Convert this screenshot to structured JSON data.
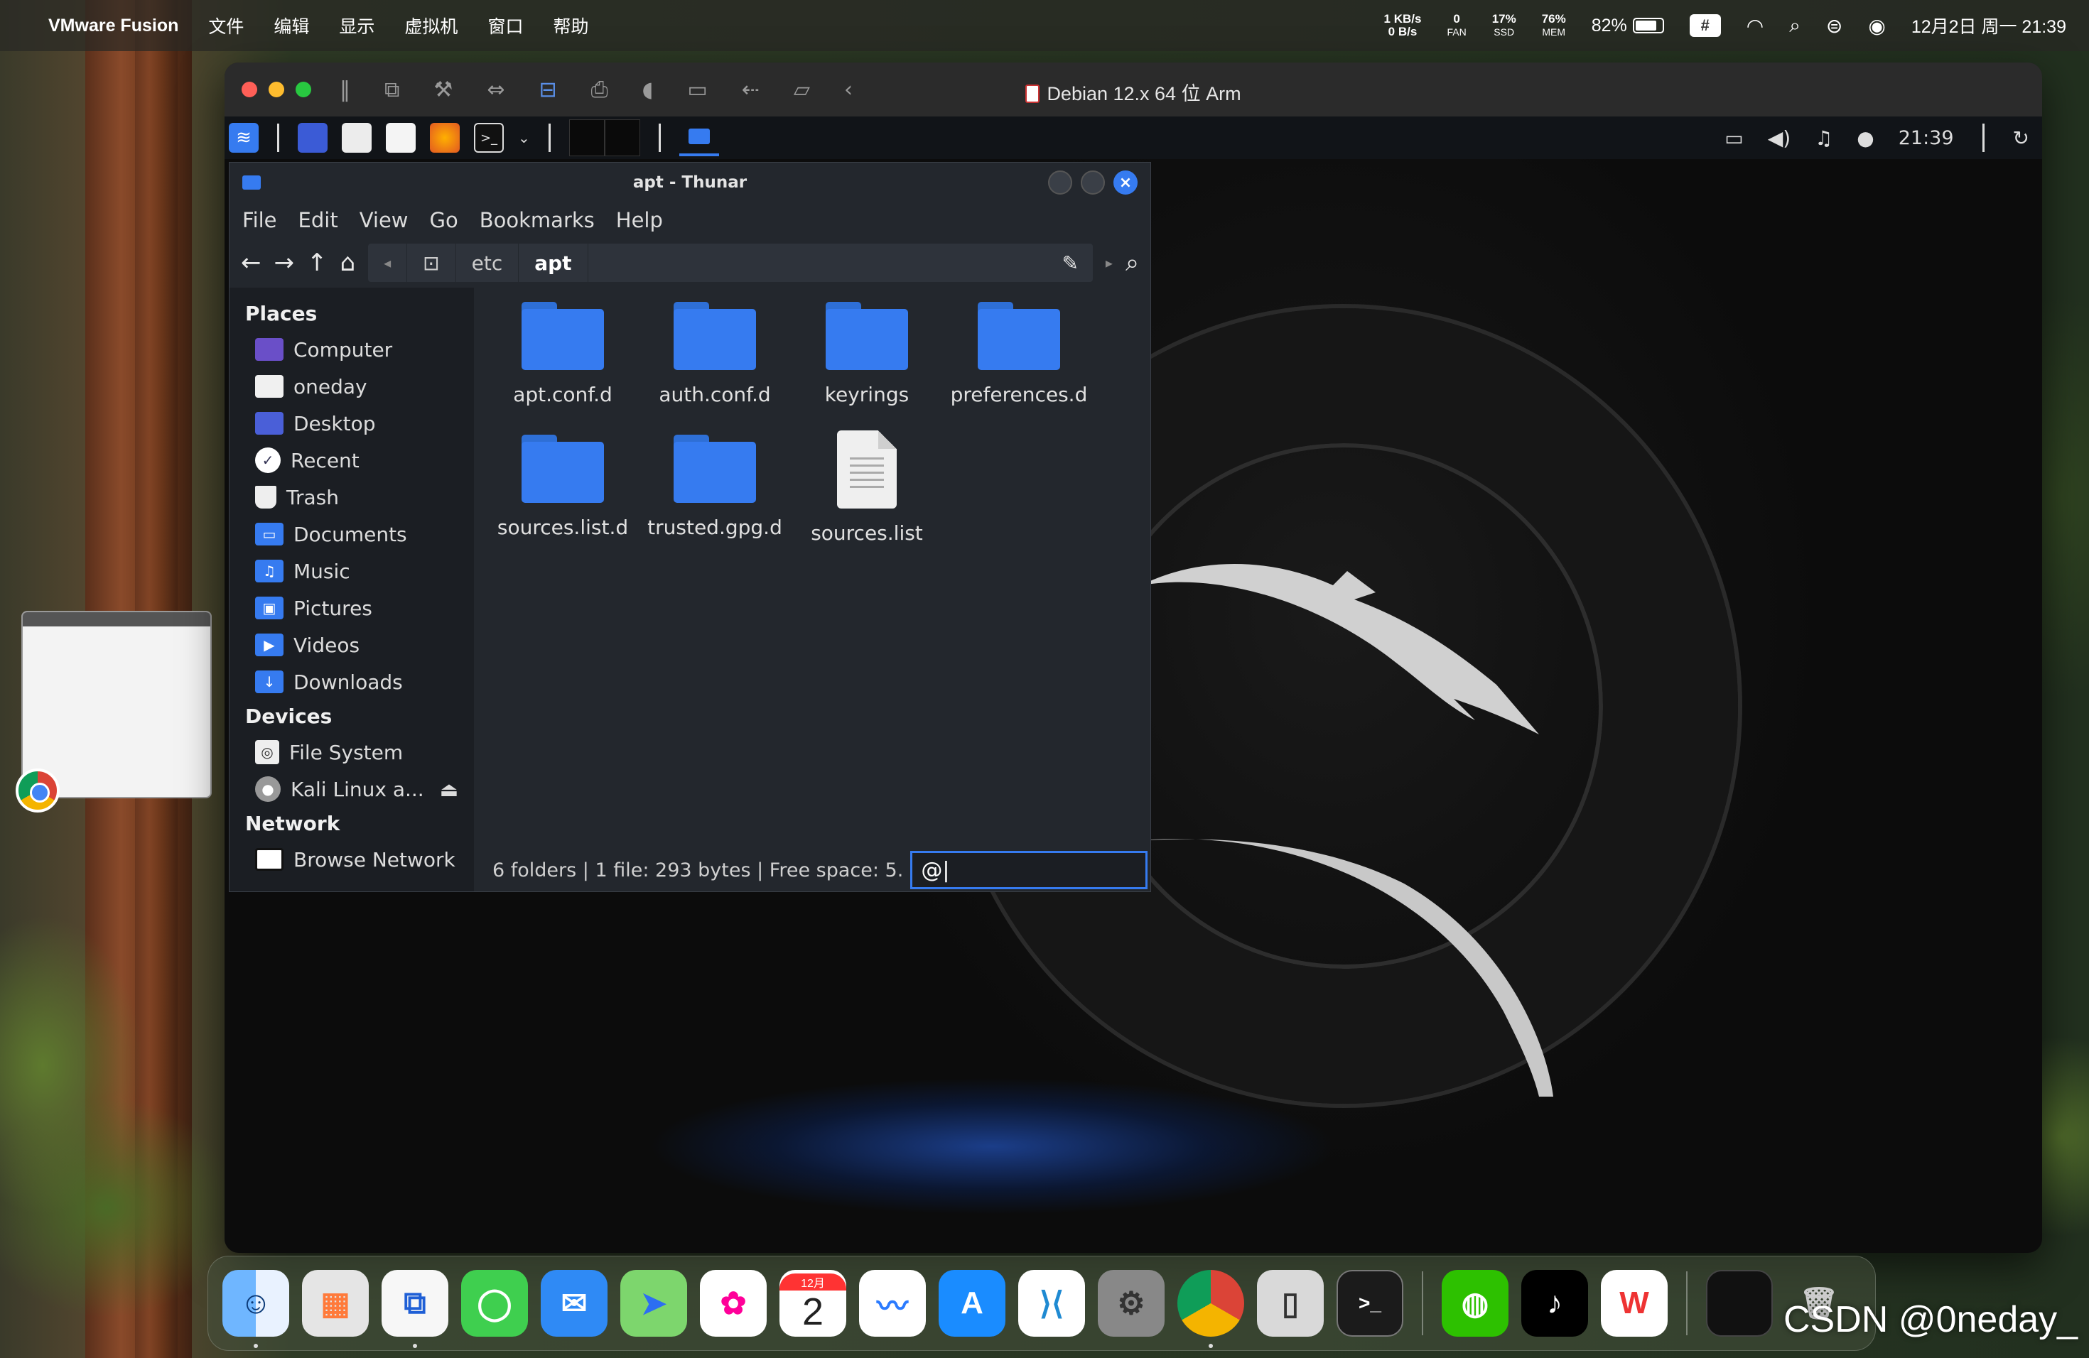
{
  "menubar": {
    "app_name": "VMware Fusion",
    "items": [
      "文件",
      "编辑",
      "显示",
      "虚拟机",
      "窗口",
      "帮助"
    ],
    "net_up": "1 KB/s",
    "net_down": "0 B/s",
    "fan_value": "0",
    "fan_label": "FAN",
    "ssd_value": "17%",
    "ssd_label": "SSD",
    "mem_value": "76%",
    "mem_label": "MEM",
    "battery": "82%",
    "battery_level": 0.82,
    "datetime": "12月2日 周一  21:39"
  },
  "vmware": {
    "title": "Debian 12.x 64 位 Arm"
  },
  "kali_panel": {
    "clock": "21:39"
  },
  "thunar": {
    "title": "apt - Thunar",
    "menu": [
      "File",
      "Edit",
      "View",
      "Go",
      "Bookmarks",
      "Help"
    ],
    "path": [
      "etc",
      "apt"
    ],
    "sidebar": {
      "places_label": "Places",
      "places": [
        {
          "label": "Computer",
          "icon": "computer-icon"
        },
        {
          "label": "oneday",
          "icon": "home-folder-icon"
        },
        {
          "label": "Desktop",
          "icon": "desktop-icon"
        },
        {
          "label": "Recent",
          "icon": "recent-icon"
        },
        {
          "label": "Trash",
          "icon": "trash-icon"
        },
        {
          "label": "Documents",
          "icon": "documents-folder-icon"
        },
        {
          "label": "Music",
          "icon": "music-folder-icon"
        },
        {
          "label": "Pictures",
          "icon": "pictures-folder-icon"
        },
        {
          "label": "Videos",
          "icon": "videos-folder-icon"
        },
        {
          "label": "Downloads",
          "icon": "downloads-folder-icon"
        }
      ],
      "devices_label": "Devices",
      "devices": [
        {
          "label": "File System",
          "icon": "drive-icon"
        },
        {
          "label": "Kali Linux a...",
          "icon": "disc-icon"
        }
      ],
      "network_label": "Network",
      "network": [
        {
          "label": "Browse Network",
          "icon": "network-icon"
        }
      ]
    },
    "files": [
      {
        "name": "apt.conf.d",
        "type": "folder"
      },
      {
        "name": "auth.conf.d",
        "type": "folder"
      },
      {
        "name": "keyrings",
        "type": "folder"
      },
      {
        "name": "preferences.d",
        "type": "folder"
      },
      {
        "name": "sources.list.d",
        "type": "folder"
      },
      {
        "name": "trusted.gpg.d",
        "type": "folder"
      },
      {
        "name": "sources.list",
        "type": "file"
      }
    ],
    "status": "6 folders  |  1 file: 293 bytes  |  Free space: 5.",
    "search_value": "@|"
  },
  "dock": {
    "calendar_month": "12月",
    "calendar_day": "2"
  },
  "watermark": "CSDN @0neday_"
}
